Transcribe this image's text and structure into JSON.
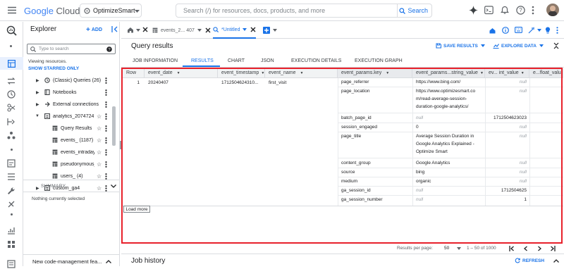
{
  "topbar": {
    "logo_google": "Google",
    "logo_cloud": "Cloud",
    "project": "OptimizeSmart",
    "search_placeholder": "Search (/) for resources, docs, products, and more",
    "search_button": "Search"
  },
  "explorer": {
    "title": "Explorer",
    "add_label": "ADD",
    "filter_placeholder": "Type to search",
    "viewing": "Viewing resources.",
    "show_starred": "SHOW STARRED ONLY",
    "items": [
      {
        "label": "(Classic) Queries (26)"
      },
      {
        "label": "Notebooks"
      },
      {
        "label": "External connections"
      },
      {
        "label": "analytics_20747245"
      },
      {
        "label": "Query Results"
      },
      {
        "label": "events_ (1187)"
      },
      {
        "label": "events_intraday_"
      },
      {
        "label": "pseudonymous_users_"
      },
      {
        "label": "users_ (4)"
      },
      {
        "label": "custom_ga4"
      }
    ],
    "summary_label": "SUMMARY",
    "nothing_selected": "Nothing currently selected",
    "banner": "New code-management fea..."
  },
  "editor_tabs": {
    "tab1": "events_2... 407",
    "tab2": "*Untitled"
  },
  "query_results": {
    "title": "Query results",
    "save_results": "SAVE RESULTS",
    "explore_data": "EXPLORE DATA",
    "subtabs": [
      "JOB INFORMATION",
      "RESULTS",
      "CHART",
      "JSON",
      "EXECUTION DETAILS",
      "EXECUTION GRAPH"
    ]
  },
  "table": {
    "columns": [
      "Row",
      "event_date",
      "event_timestamp",
      "event_name",
      "event_params.key",
      "event_params...string_value",
      "ev... int_value",
      "e...float_valu"
    ],
    "row_num": "1",
    "event_date": "20240407",
    "event_timestamp": "1712504624310...",
    "event_name": "first_visit",
    "params": [
      {
        "key": "page_referrer",
        "string_value": "https://www.bing.com/",
        "int_value": "null"
      },
      {
        "key": "page_location",
        "string_value": "https://www.optimizesmart.co\nm/read-average-session-\nduration-google-analytics/",
        "int_value": "null"
      },
      {
        "key": "batch_page_id",
        "string_value": "null",
        "int_value": "1712504623023"
      },
      {
        "key": "session_engaged",
        "string_value": "0",
        "int_value": "null"
      },
      {
        "key": "page_title",
        "string_value": "Average Session Duration in\nGoogle Analytics Explained -\nOptimize Smart",
        "int_value": "null"
      },
      {
        "key": "content_group",
        "string_value": "Google Analytics",
        "int_value": "null"
      },
      {
        "key": "source",
        "string_value": "bing",
        "int_value": "null"
      },
      {
        "key": "medium",
        "string_value": "organic",
        "int_value": "null"
      },
      {
        "key": "ga_session_id",
        "string_value": "null",
        "int_value": "1712504625"
      },
      {
        "key": "ga_session_number",
        "string_value": "null",
        "int_value": "1"
      }
    ],
    "load_more": "Load more"
  },
  "pagination": {
    "results_per_page_label": "Results per page:",
    "per_page": "50",
    "range": "1 – 50 of 1000"
  },
  "job_history": {
    "title": "Job history",
    "refresh": "REFRESH"
  },
  "colors": {
    "accent": "#1a73e8",
    "highlight_border": "#e8212b"
  }
}
